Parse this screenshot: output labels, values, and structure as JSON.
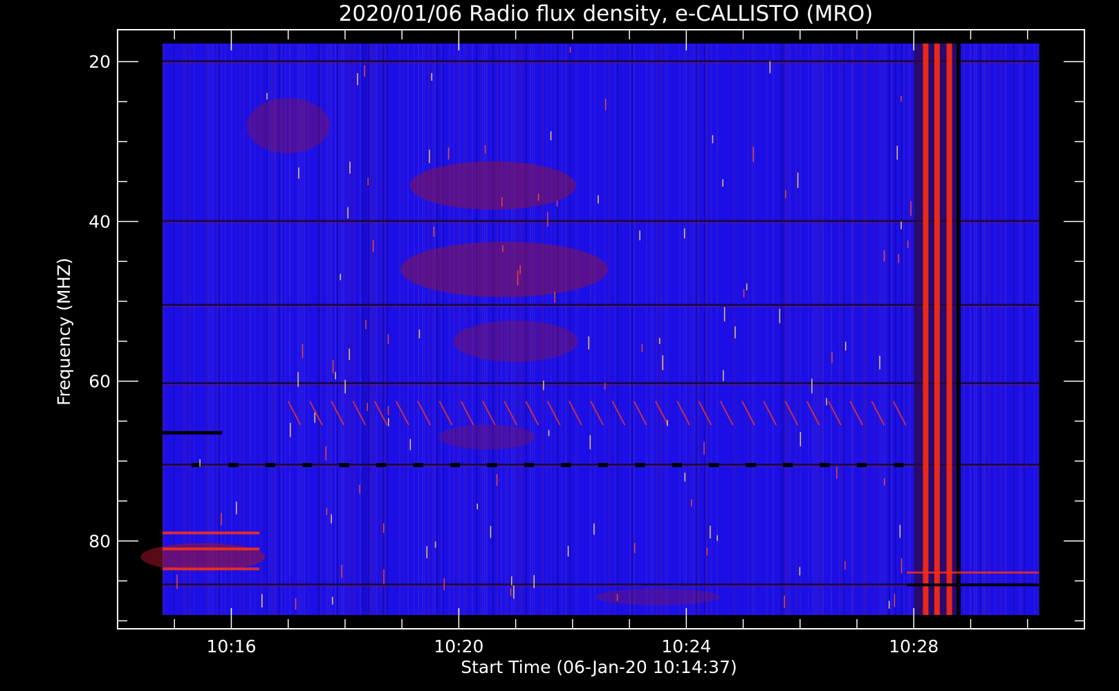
{
  "chart_data": {
    "type": "heatmap",
    "title": "2020/01/06  Radio flux density, e-CALLISTO (MRO)",
    "xlabel": "Start Time (06-Jan-20 10:14:37)",
    "ylabel": "Frequency (MHZ)",
    "x_start": "10:14:37",
    "x_range_minutes": [
      10.25,
      10.5
    ],
    "xlim": [
      "10:14",
      "10:31"
    ],
    "ylim": [
      16,
      91
    ],
    "y_inverted": true,
    "x_ticks": [
      "10:16",
      "10:20",
      "10:24",
      "10:28"
    ],
    "y_ticks": [
      20,
      40,
      60,
      80
    ],
    "x_tick_minutes": [
      16,
      20,
      24,
      28
    ],
    "x_minor_tick_minutes": [
      15,
      16,
      17,
      18,
      19,
      20,
      21,
      22,
      23,
      24,
      25,
      26,
      27,
      28,
      29,
      30
    ],
    "y_minor_ticks": [
      15,
      20,
      25,
      30,
      35,
      40,
      45,
      50,
      55,
      60,
      65,
      70,
      75,
      80,
      85,
      90
    ],
    "data_x_min": 10.25,
    "data_x_max": 10.5,
    "colormap": [
      "#000000",
      "#1a00e8",
      "#3c1ee6",
      "#b01010",
      "#ff3300",
      "#ffe060"
    ],
    "background_color": "#1b0fe8",
    "frame_color": "#ffffff",
    "horizontal_dark_bands_mhz": [
      20,
      40,
      50.5,
      60.3,
      70.5,
      85.5
    ],
    "burst_region_minutes": [
      28.0,
      28.8
    ],
    "features": [
      {
        "name": "interference lines",
        "freq_mhz": [
          20,
          40,
          50.5,
          60.3,
          70.5
        ]
      },
      {
        "name": "broadband burst",
        "start_minute": 28.0,
        "end_minute": 28.8
      }
    ]
  }
}
